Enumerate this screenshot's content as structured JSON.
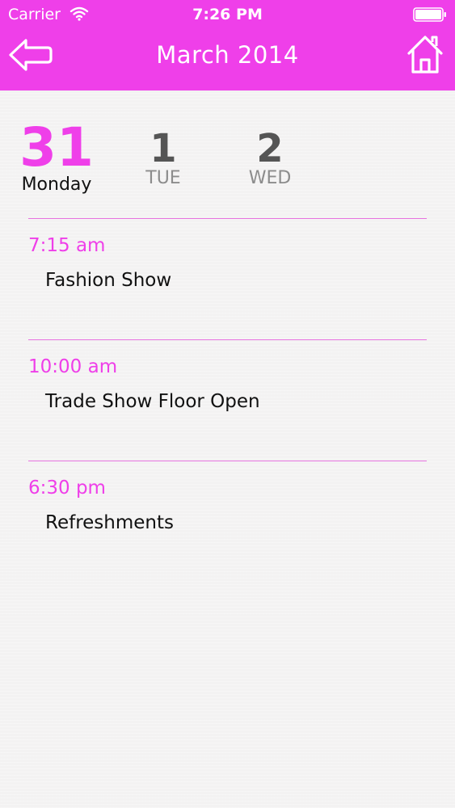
{
  "status": {
    "carrier": "Carrier",
    "time": "7:26 PM"
  },
  "nav": {
    "title": "March 2014",
    "back_icon": "back-arrow-icon",
    "home_icon": "home-icon"
  },
  "days": [
    {
      "number": "31",
      "name": "Monday",
      "selected": true
    },
    {
      "number": "1",
      "name": "TUE",
      "selected": false
    },
    {
      "number": "2",
      "name": "WED",
      "selected": false
    }
  ],
  "events": [
    {
      "time": "7:15 am",
      "title": "Fashion Show"
    },
    {
      "time": "10:00 am",
      "title": "Trade Show Floor Open"
    },
    {
      "time": "6:30 pm",
      "title": "Refreshments"
    }
  ],
  "colors": {
    "accent": "#ef3fe9",
    "divider": "#e672df",
    "background": "#f3f2f2"
  }
}
